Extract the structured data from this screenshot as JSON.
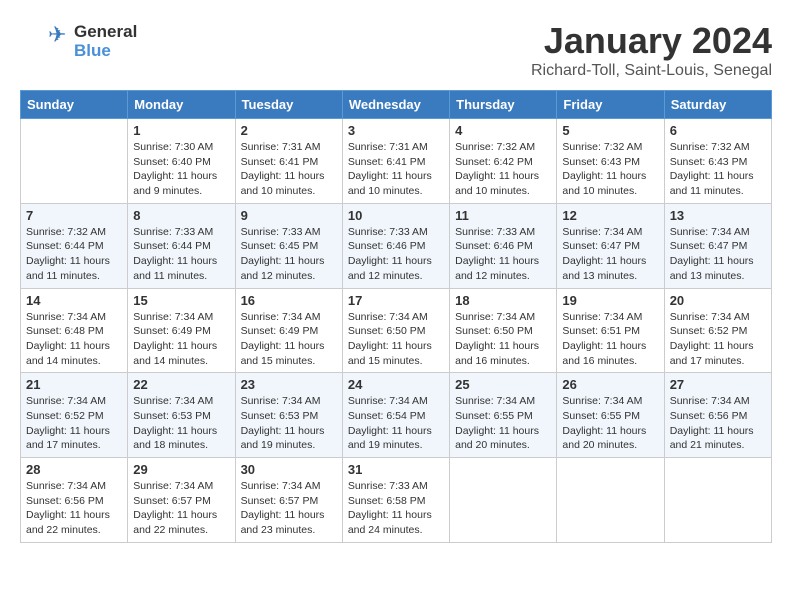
{
  "header": {
    "logo_general": "General",
    "logo_blue": "Blue",
    "title": "January 2024",
    "subtitle": "Richard-Toll, Saint-Louis, Senegal"
  },
  "weekdays": [
    "Sunday",
    "Monday",
    "Tuesday",
    "Wednesday",
    "Thursday",
    "Friday",
    "Saturday"
  ],
  "weeks": [
    [
      {
        "day": "",
        "sunrise": "",
        "sunset": "",
        "daylight": ""
      },
      {
        "day": "1",
        "sunrise": "Sunrise: 7:30 AM",
        "sunset": "Sunset: 6:40 PM",
        "daylight": "Daylight: 11 hours and 9 minutes."
      },
      {
        "day": "2",
        "sunrise": "Sunrise: 7:31 AM",
        "sunset": "Sunset: 6:41 PM",
        "daylight": "Daylight: 11 hours and 10 minutes."
      },
      {
        "day": "3",
        "sunrise": "Sunrise: 7:31 AM",
        "sunset": "Sunset: 6:41 PM",
        "daylight": "Daylight: 11 hours and 10 minutes."
      },
      {
        "day": "4",
        "sunrise": "Sunrise: 7:32 AM",
        "sunset": "Sunset: 6:42 PM",
        "daylight": "Daylight: 11 hours and 10 minutes."
      },
      {
        "day": "5",
        "sunrise": "Sunrise: 7:32 AM",
        "sunset": "Sunset: 6:43 PM",
        "daylight": "Daylight: 11 hours and 10 minutes."
      },
      {
        "day": "6",
        "sunrise": "Sunrise: 7:32 AM",
        "sunset": "Sunset: 6:43 PM",
        "daylight": "Daylight: 11 hours and 11 minutes."
      }
    ],
    [
      {
        "day": "7",
        "sunrise": "Sunrise: 7:32 AM",
        "sunset": "Sunset: 6:44 PM",
        "daylight": "Daylight: 11 hours and 11 minutes."
      },
      {
        "day": "8",
        "sunrise": "Sunrise: 7:33 AM",
        "sunset": "Sunset: 6:44 PM",
        "daylight": "Daylight: 11 hours and 11 minutes."
      },
      {
        "day": "9",
        "sunrise": "Sunrise: 7:33 AM",
        "sunset": "Sunset: 6:45 PM",
        "daylight": "Daylight: 11 hours and 12 minutes."
      },
      {
        "day": "10",
        "sunrise": "Sunrise: 7:33 AM",
        "sunset": "Sunset: 6:46 PM",
        "daylight": "Daylight: 11 hours and 12 minutes."
      },
      {
        "day": "11",
        "sunrise": "Sunrise: 7:33 AM",
        "sunset": "Sunset: 6:46 PM",
        "daylight": "Daylight: 11 hours and 12 minutes."
      },
      {
        "day": "12",
        "sunrise": "Sunrise: 7:34 AM",
        "sunset": "Sunset: 6:47 PM",
        "daylight": "Daylight: 11 hours and 13 minutes."
      },
      {
        "day": "13",
        "sunrise": "Sunrise: 7:34 AM",
        "sunset": "Sunset: 6:47 PM",
        "daylight": "Daylight: 11 hours and 13 minutes."
      }
    ],
    [
      {
        "day": "14",
        "sunrise": "Sunrise: 7:34 AM",
        "sunset": "Sunset: 6:48 PM",
        "daylight": "Daylight: 11 hours and 14 minutes."
      },
      {
        "day": "15",
        "sunrise": "Sunrise: 7:34 AM",
        "sunset": "Sunset: 6:49 PM",
        "daylight": "Daylight: 11 hours and 14 minutes."
      },
      {
        "day": "16",
        "sunrise": "Sunrise: 7:34 AM",
        "sunset": "Sunset: 6:49 PM",
        "daylight": "Daylight: 11 hours and 15 minutes."
      },
      {
        "day": "17",
        "sunrise": "Sunrise: 7:34 AM",
        "sunset": "Sunset: 6:50 PM",
        "daylight": "Daylight: 11 hours and 15 minutes."
      },
      {
        "day": "18",
        "sunrise": "Sunrise: 7:34 AM",
        "sunset": "Sunset: 6:50 PM",
        "daylight": "Daylight: 11 hours and 16 minutes."
      },
      {
        "day": "19",
        "sunrise": "Sunrise: 7:34 AM",
        "sunset": "Sunset: 6:51 PM",
        "daylight": "Daylight: 11 hours and 16 minutes."
      },
      {
        "day": "20",
        "sunrise": "Sunrise: 7:34 AM",
        "sunset": "Sunset: 6:52 PM",
        "daylight": "Daylight: 11 hours and 17 minutes."
      }
    ],
    [
      {
        "day": "21",
        "sunrise": "Sunrise: 7:34 AM",
        "sunset": "Sunset: 6:52 PM",
        "daylight": "Daylight: 11 hours and 17 minutes."
      },
      {
        "day": "22",
        "sunrise": "Sunrise: 7:34 AM",
        "sunset": "Sunset: 6:53 PM",
        "daylight": "Daylight: 11 hours and 18 minutes."
      },
      {
        "day": "23",
        "sunrise": "Sunrise: 7:34 AM",
        "sunset": "Sunset: 6:53 PM",
        "daylight": "Daylight: 11 hours and 19 minutes."
      },
      {
        "day": "24",
        "sunrise": "Sunrise: 7:34 AM",
        "sunset": "Sunset: 6:54 PM",
        "daylight": "Daylight: 11 hours and 19 minutes."
      },
      {
        "day": "25",
        "sunrise": "Sunrise: 7:34 AM",
        "sunset": "Sunset: 6:55 PM",
        "daylight": "Daylight: 11 hours and 20 minutes."
      },
      {
        "day": "26",
        "sunrise": "Sunrise: 7:34 AM",
        "sunset": "Sunset: 6:55 PM",
        "daylight": "Daylight: 11 hours and 20 minutes."
      },
      {
        "day": "27",
        "sunrise": "Sunrise: 7:34 AM",
        "sunset": "Sunset: 6:56 PM",
        "daylight": "Daylight: 11 hours and 21 minutes."
      }
    ],
    [
      {
        "day": "28",
        "sunrise": "Sunrise: 7:34 AM",
        "sunset": "Sunset: 6:56 PM",
        "daylight": "Daylight: 11 hours and 22 minutes."
      },
      {
        "day": "29",
        "sunrise": "Sunrise: 7:34 AM",
        "sunset": "Sunset: 6:57 PM",
        "daylight": "Daylight: 11 hours and 22 minutes."
      },
      {
        "day": "30",
        "sunrise": "Sunrise: 7:34 AM",
        "sunset": "Sunset: 6:57 PM",
        "daylight": "Daylight: 11 hours and 23 minutes."
      },
      {
        "day": "31",
        "sunrise": "Sunrise: 7:33 AM",
        "sunset": "Sunset: 6:58 PM",
        "daylight": "Daylight: 11 hours and 24 minutes."
      },
      {
        "day": "",
        "sunrise": "",
        "sunset": "",
        "daylight": ""
      },
      {
        "day": "",
        "sunrise": "",
        "sunset": "",
        "daylight": ""
      },
      {
        "day": "",
        "sunrise": "",
        "sunset": "",
        "daylight": ""
      }
    ]
  ]
}
